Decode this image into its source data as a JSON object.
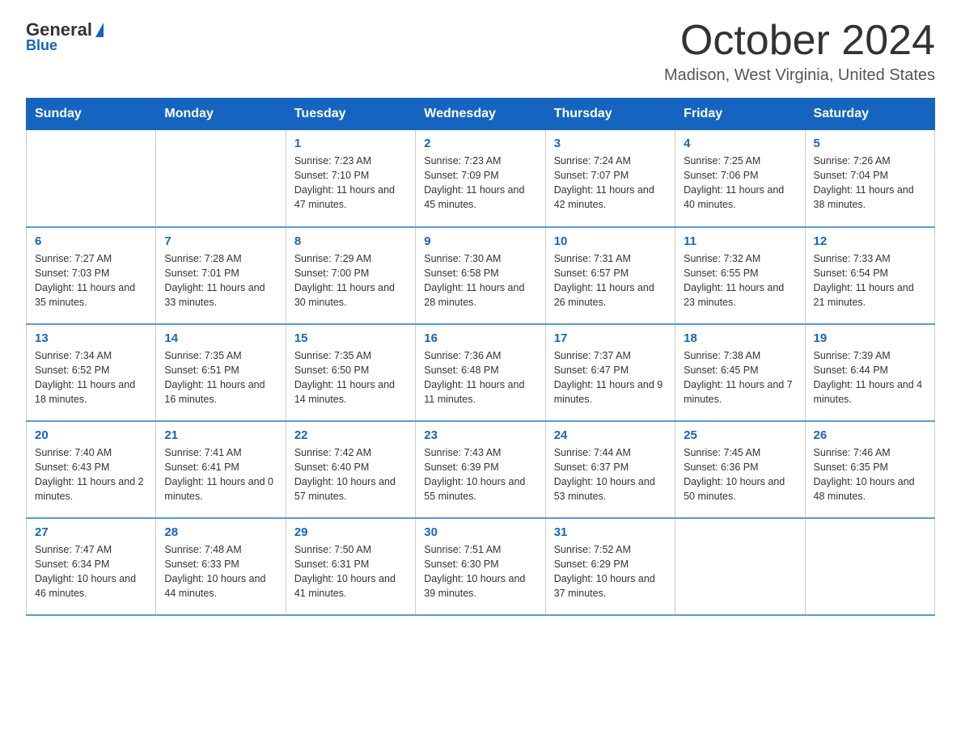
{
  "logo": {
    "general": "General",
    "blue": "Blue"
  },
  "header": {
    "month": "October 2024",
    "location": "Madison, West Virginia, United States"
  },
  "days_of_week": [
    "Sunday",
    "Monday",
    "Tuesday",
    "Wednesday",
    "Thursday",
    "Friday",
    "Saturday"
  ],
  "weeks": [
    [
      {
        "day": "",
        "info": ""
      },
      {
        "day": "",
        "info": ""
      },
      {
        "day": "1",
        "info": "Sunrise: 7:23 AM\nSunset: 7:10 PM\nDaylight: 11 hours\nand 47 minutes."
      },
      {
        "day": "2",
        "info": "Sunrise: 7:23 AM\nSunset: 7:09 PM\nDaylight: 11 hours\nand 45 minutes."
      },
      {
        "day": "3",
        "info": "Sunrise: 7:24 AM\nSunset: 7:07 PM\nDaylight: 11 hours\nand 42 minutes."
      },
      {
        "day": "4",
        "info": "Sunrise: 7:25 AM\nSunset: 7:06 PM\nDaylight: 11 hours\nand 40 minutes."
      },
      {
        "day": "5",
        "info": "Sunrise: 7:26 AM\nSunset: 7:04 PM\nDaylight: 11 hours\nand 38 minutes."
      }
    ],
    [
      {
        "day": "6",
        "info": "Sunrise: 7:27 AM\nSunset: 7:03 PM\nDaylight: 11 hours\nand 35 minutes."
      },
      {
        "day": "7",
        "info": "Sunrise: 7:28 AM\nSunset: 7:01 PM\nDaylight: 11 hours\nand 33 minutes."
      },
      {
        "day": "8",
        "info": "Sunrise: 7:29 AM\nSunset: 7:00 PM\nDaylight: 11 hours\nand 30 minutes."
      },
      {
        "day": "9",
        "info": "Sunrise: 7:30 AM\nSunset: 6:58 PM\nDaylight: 11 hours\nand 28 minutes."
      },
      {
        "day": "10",
        "info": "Sunrise: 7:31 AM\nSunset: 6:57 PM\nDaylight: 11 hours\nand 26 minutes."
      },
      {
        "day": "11",
        "info": "Sunrise: 7:32 AM\nSunset: 6:55 PM\nDaylight: 11 hours\nand 23 minutes."
      },
      {
        "day": "12",
        "info": "Sunrise: 7:33 AM\nSunset: 6:54 PM\nDaylight: 11 hours\nand 21 minutes."
      }
    ],
    [
      {
        "day": "13",
        "info": "Sunrise: 7:34 AM\nSunset: 6:52 PM\nDaylight: 11 hours\nand 18 minutes."
      },
      {
        "day": "14",
        "info": "Sunrise: 7:35 AM\nSunset: 6:51 PM\nDaylight: 11 hours\nand 16 minutes."
      },
      {
        "day": "15",
        "info": "Sunrise: 7:35 AM\nSunset: 6:50 PM\nDaylight: 11 hours\nand 14 minutes."
      },
      {
        "day": "16",
        "info": "Sunrise: 7:36 AM\nSunset: 6:48 PM\nDaylight: 11 hours\nand 11 minutes."
      },
      {
        "day": "17",
        "info": "Sunrise: 7:37 AM\nSunset: 6:47 PM\nDaylight: 11 hours\nand 9 minutes."
      },
      {
        "day": "18",
        "info": "Sunrise: 7:38 AM\nSunset: 6:45 PM\nDaylight: 11 hours\nand 7 minutes."
      },
      {
        "day": "19",
        "info": "Sunrise: 7:39 AM\nSunset: 6:44 PM\nDaylight: 11 hours\nand 4 minutes."
      }
    ],
    [
      {
        "day": "20",
        "info": "Sunrise: 7:40 AM\nSunset: 6:43 PM\nDaylight: 11 hours\nand 2 minutes."
      },
      {
        "day": "21",
        "info": "Sunrise: 7:41 AM\nSunset: 6:41 PM\nDaylight: 11 hours\nand 0 minutes."
      },
      {
        "day": "22",
        "info": "Sunrise: 7:42 AM\nSunset: 6:40 PM\nDaylight: 10 hours\nand 57 minutes."
      },
      {
        "day": "23",
        "info": "Sunrise: 7:43 AM\nSunset: 6:39 PM\nDaylight: 10 hours\nand 55 minutes."
      },
      {
        "day": "24",
        "info": "Sunrise: 7:44 AM\nSunset: 6:37 PM\nDaylight: 10 hours\nand 53 minutes."
      },
      {
        "day": "25",
        "info": "Sunrise: 7:45 AM\nSunset: 6:36 PM\nDaylight: 10 hours\nand 50 minutes."
      },
      {
        "day": "26",
        "info": "Sunrise: 7:46 AM\nSunset: 6:35 PM\nDaylight: 10 hours\nand 48 minutes."
      }
    ],
    [
      {
        "day": "27",
        "info": "Sunrise: 7:47 AM\nSunset: 6:34 PM\nDaylight: 10 hours\nand 46 minutes."
      },
      {
        "day": "28",
        "info": "Sunrise: 7:48 AM\nSunset: 6:33 PM\nDaylight: 10 hours\nand 44 minutes."
      },
      {
        "day": "29",
        "info": "Sunrise: 7:50 AM\nSunset: 6:31 PM\nDaylight: 10 hours\nand 41 minutes."
      },
      {
        "day": "30",
        "info": "Sunrise: 7:51 AM\nSunset: 6:30 PM\nDaylight: 10 hours\nand 39 minutes."
      },
      {
        "day": "31",
        "info": "Sunrise: 7:52 AM\nSunset: 6:29 PM\nDaylight: 10 hours\nand 37 minutes."
      },
      {
        "day": "",
        "info": ""
      },
      {
        "day": "",
        "info": ""
      }
    ]
  ]
}
